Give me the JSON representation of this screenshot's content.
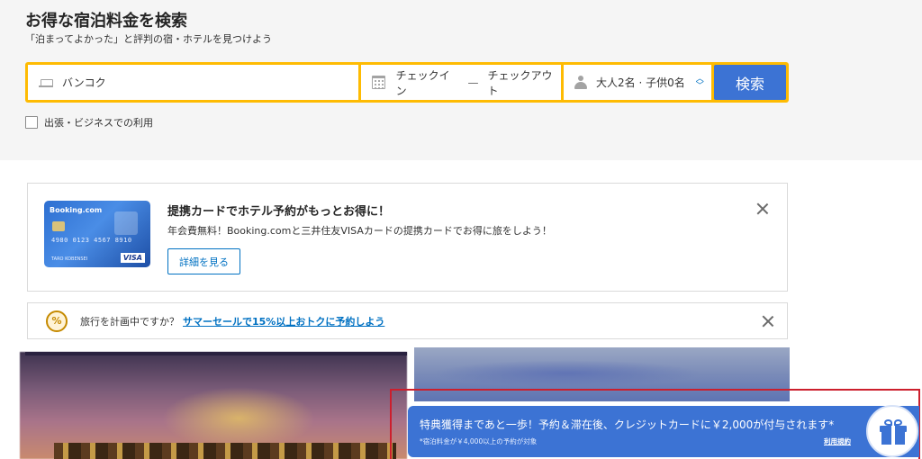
{
  "header": {
    "title": "お得な宿泊料金を検索",
    "subtitle": "「泊まってよかった」と評判の宿・ホテルを見つけよう"
  },
  "search": {
    "destination": "バンコク",
    "checkin": "チェックイン",
    "separator": "—",
    "checkout": "チェックアウト",
    "guests": "大人2名 · 子供0名",
    "button_label": "検索"
  },
  "business_trip": {
    "label": "出張・ビジネスでの利用",
    "checked": false
  },
  "card_promo": {
    "card_brand": "Booking.com",
    "card_number": "4980 0123 4567 8910",
    "card_holder": "TARO KOBENSEI",
    "card_network": "VISA",
    "title": "提携カードでホテル予約がもっとお得に！",
    "body": "年会費無料！Booking.comと三井住友VISAカードの提携カードでお得に旅をしよう！",
    "button_label": "詳細を見る"
  },
  "travel_notice": {
    "icon_text": "%",
    "text": "旅行を計画中ですか？",
    "link": "サマーセールで15%以上おトクに予約しよう"
  },
  "reward_banner": {
    "title": "特典獲得まであと一歩！予約＆滞在後、クレジットカードに￥2,000が付与されます*",
    "note": "*宿泊料金が￥4,000以上の予約が対象",
    "terms": "利用規約"
  },
  "colors": {
    "brand_blue": "#3c73d4",
    "search_border": "#febb02",
    "link_blue": "#0071c2",
    "highlight_red": "#cc1f2d"
  },
  "icons": {
    "destination": "bed-icon",
    "dates": "calendar-icon",
    "guests": "person-icon",
    "guests_toggle": "chevron-updown-icon",
    "close": "close-icon",
    "sale": "sale-badge-icon",
    "gift": "gift-icon"
  }
}
